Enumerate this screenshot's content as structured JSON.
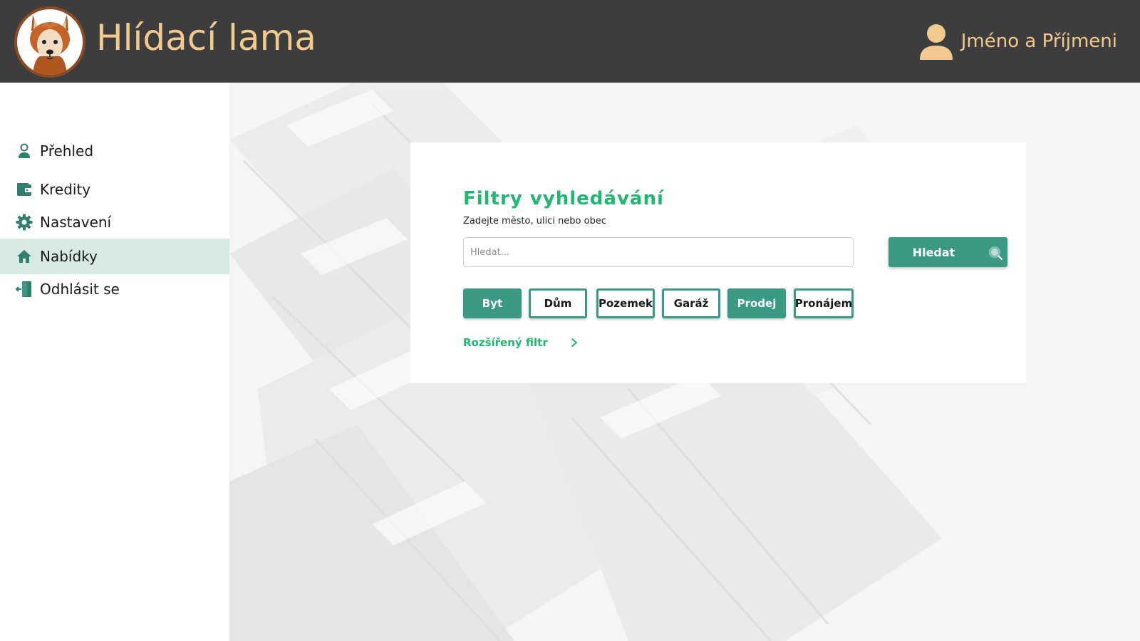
{
  "header": {
    "app_title": "Hlídací lama",
    "user_name": "Jméno a Příjmeni",
    "logo_icon": "llama-logo",
    "user_icon": "user-icon"
  },
  "sidebar": {
    "items": [
      {
        "label": "Přehled",
        "icon": "person-icon",
        "active": false
      },
      {
        "label": "Kredity",
        "icon": "wallet-icon",
        "active": false
      },
      {
        "label": "Nastavení",
        "icon": "gear-icon",
        "active": false
      },
      {
        "label": "Nabídky",
        "icon": "home-icon",
        "active": true
      },
      {
        "label": "Odhlásit se",
        "icon": "logout-icon",
        "active": false
      }
    ]
  },
  "filter": {
    "title": "Filtry vyhledávání",
    "subtitle": "Zadejte město, ulici nebo obec",
    "search_placeholder": "Hledat...",
    "search_value": "",
    "search_button_label": "Hledat",
    "search_button_icon": "search-icon",
    "chips": [
      {
        "label": "Byt",
        "selected": true
      },
      {
        "label": "Dům",
        "selected": false
      },
      {
        "label": "Pozemek",
        "selected": false
      },
      {
        "label": "Garáž",
        "selected": false
      },
      {
        "label": "Prodej",
        "selected": true
      },
      {
        "label": "Pronájem",
        "selected": false
      }
    ],
    "advanced_label": "Rozšířený filtr",
    "advanced_icon": "chevron-right-icon"
  },
  "colors": {
    "header_bg": "#3d3d3d",
    "header_text": "#f2c98e",
    "accent": "#3a9a83",
    "title_green": "#1fb871",
    "active_nav_bg": "#d7e9e3"
  }
}
